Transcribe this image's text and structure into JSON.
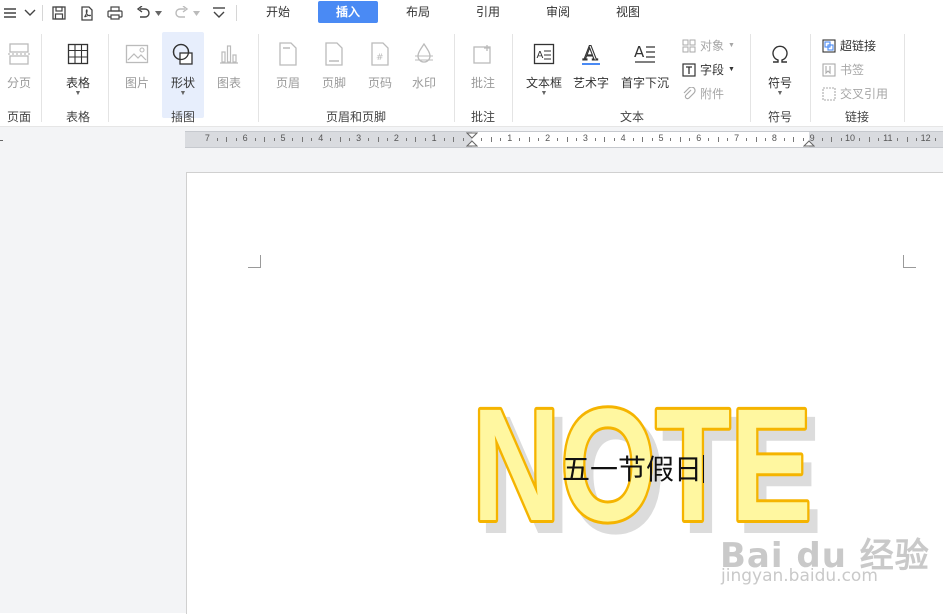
{
  "tabs": [
    "开始",
    "插入",
    "布局",
    "引用",
    "审阅",
    "视图"
  ],
  "active_tab": "插入",
  "ribbon": {
    "page": {
      "break_label": "分页",
      "group": "页面"
    },
    "table": {
      "label": "表格",
      "group": "表格"
    },
    "illustration": {
      "picture": "图片",
      "shape": "形状",
      "chart": "图表",
      "group": "插图"
    },
    "header_footer": {
      "header": "页眉",
      "footer": "页脚",
      "page_number": "页码",
      "watermark": "水印",
      "group": "页眉和页脚"
    },
    "comment": {
      "label": "批注",
      "group": "批注"
    },
    "text": {
      "textbox": "文本框",
      "wordart": "艺术字",
      "dropcap": "首字下沉",
      "object": "对象",
      "field": "字段",
      "attachment": "附件",
      "group": "文本"
    },
    "symbol": {
      "label": "符号",
      "group": "符号"
    },
    "link": {
      "hyperlink": "超链接",
      "bookmark": "书签",
      "cross_ref": "交叉引用",
      "group": "链接"
    }
  },
  "ruler": {
    "left_numbers": [
      "7",
      "6",
      "5",
      "4",
      "3",
      "2",
      "1"
    ],
    "right_numbers": [
      "1",
      "2",
      "3",
      "4",
      "5",
      "6",
      "7",
      "8",
      "9",
      "10",
      "11",
      "12"
    ]
  },
  "document": {
    "wordart_text": "NOTE",
    "body_text": "五一节假日"
  },
  "watermark": {
    "brand": "Bai du 经验",
    "url": "jingyan.baidu.com"
  },
  "colors": {
    "accent": "#4a8af4",
    "wordart_fill": "#fff7a0",
    "wordart_stroke": "#f5b400",
    "wordart_shadow": "#d9d9d9"
  }
}
